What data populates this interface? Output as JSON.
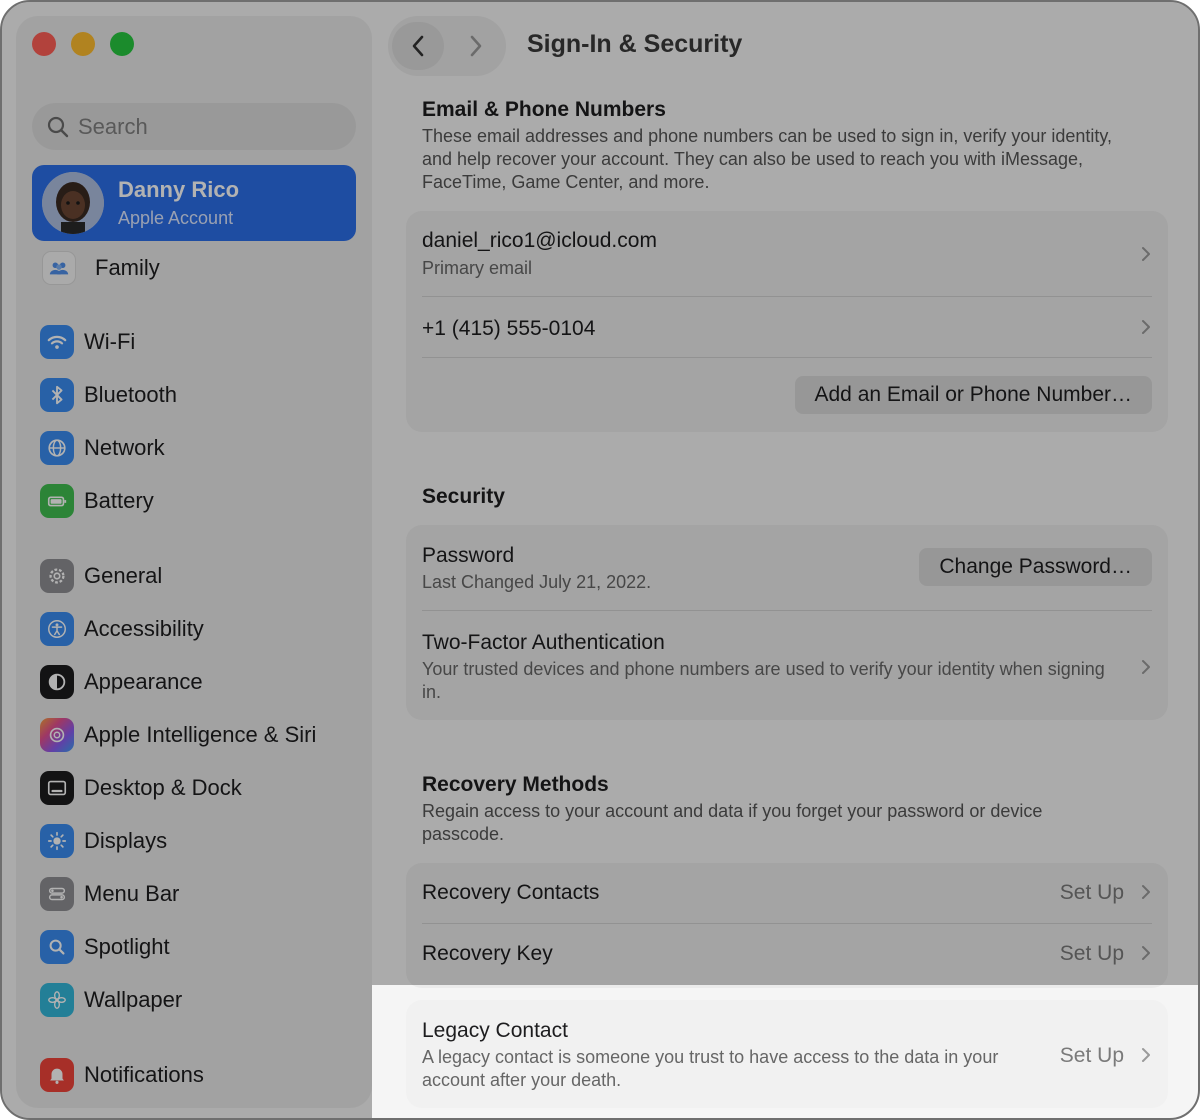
{
  "sidebar": {
    "search_placeholder": "Search",
    "account": {
      "name": "Danny Rico",
      "subtitle": "Apple Account"
    },
    "items": [
      {
        "label": "Family",
        "icon": "family-icon"
      },
      {
        "label": "Wi-Fi",
        "icon": "wifi-icon"
      },
      {
        "label": "Bluetooth",
        "icon": "bluetooth-icon"
      },
      {
        "label": "Network",
        "icon": "network-globe-icon"
      },
      {
        "label": "Battery",
        "icon": "battery-icon"
      },
      {
        "label": "General",
        "icon": "gear-icon"
      },
      {
        "label": "Accessibility",
        "icon": "accessibility-icon"
      },
      {
        "label": "Appearance",
        "icon": "appearance-icon"
      },
      {
        "label": "Apple Intelligence & Siri",
        "icon": "siri-icon"
      },
      {
        "label": "Desktop & Dock",
        "icon": "dock-icon"
      },
      {
        "label": "Displays",
        "icon": "sun-icon"
      },
      {
        "label": "Menu Bar",
        "icon": "menu-bar-icon"
      },
      {
        "label": "Spotlight",
        "icon": "magnifier-icon"
      },
      {
        "label": "Wallpaper",
        "icon": "flower-icon"
      },
      {
        "label": "Notifications",
        "icon": "bell-icon"
      }
    ]
  },
  "header": {
    "title": "Sign-In & Security"
  },
  "email_section": {
    "title": "Email & Phone Numbers",
    "description": "These email addresses and phone numbers can be used to sign in, verify your identity, and help recover your account. They can also be used to reach you with iMessage, FaceTime, Game Center, and more.",
    "email": "daniel_rico1@icloud.com",
    "email_label": "Primary email",
    "phone": "+1 (415) 555-0104",
    "add_button": "Add an Email or Phone Number…"
  },
  "security_section": {
    "title": "Security",
    "password_title": "Password",
    "password_sub": "Last Changed July 21, 2022.",
    "change_button": "Change Password…",
    "tfa_title": "Two-Factor Authentication",
    "tfa_sub": "Your trusted devices and phone numbers are used to verify your identity when signing in."
  },
  "recovery_section": {
    "title": "Recovery Methods",
    "description": "Regain access to your account and data if you forget your password or device passcode.",
    "contacts_title": "Recovery Contacts",
    "contacts_action": "Set Up",
    "key_title": "Recovery Key",
    "key_action": "Set Up"
  },
  "legacy": {
    "title": "Legacy Contact",
    "description": "A legacy contact is someone you trust to have access to the data in your account after your death.",
    "action": "Set Up"
  },
  "colors": {
    "accent": "#2c6fe8",
    "close": "#ff5f57",
    "minimize": "#febc2e",
    "zoom": "#28c840"
  }
}
